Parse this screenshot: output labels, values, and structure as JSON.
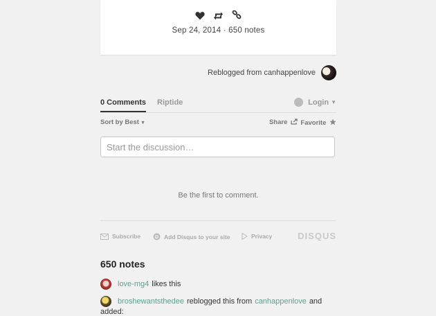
{
  "post": {
    "date_notes": "Sep 24, 2014 · 650 notes",
    "icons": [
      "heart-icon",
      "reblog-icon",
      "link-icon"
    ]
  },
  "reblog": {
    "text": "Reblogged from canhappenlove"
  },
  "comments": {
    "tab_comments": "0 Comments",
    "tab_riptide": "Riptide",
    "login": "Login",
    "sort": "Sort by Best",
    "share": "Share",
    "favorite": "Favorite",
    "input_placeholder": "Start the discussion…",
    "empty": "Be the first to comment."
  },
  "footer": {
    "subscribe": "Subscribe",
    "add_disqus": "Add Disqus to your site",
    "privacy": "Privacy",
    "logo": "DISQUS"
  },
  "notes": {
    "title": "650 notes",
    "items": [
      {
        "user": "love-mg4",
        "text": "likes this"
      },
      {
        "user": "broshewantsthedee",
        "text": "reblogged this from",
        "source": "canhappenlove",
        "suffix": "and",
        "continuation": "added:"
      }
    ]
  },
  "colors": {
    "link": "#5fa08e",
    "background": "#f1f1f1"
  }
}
